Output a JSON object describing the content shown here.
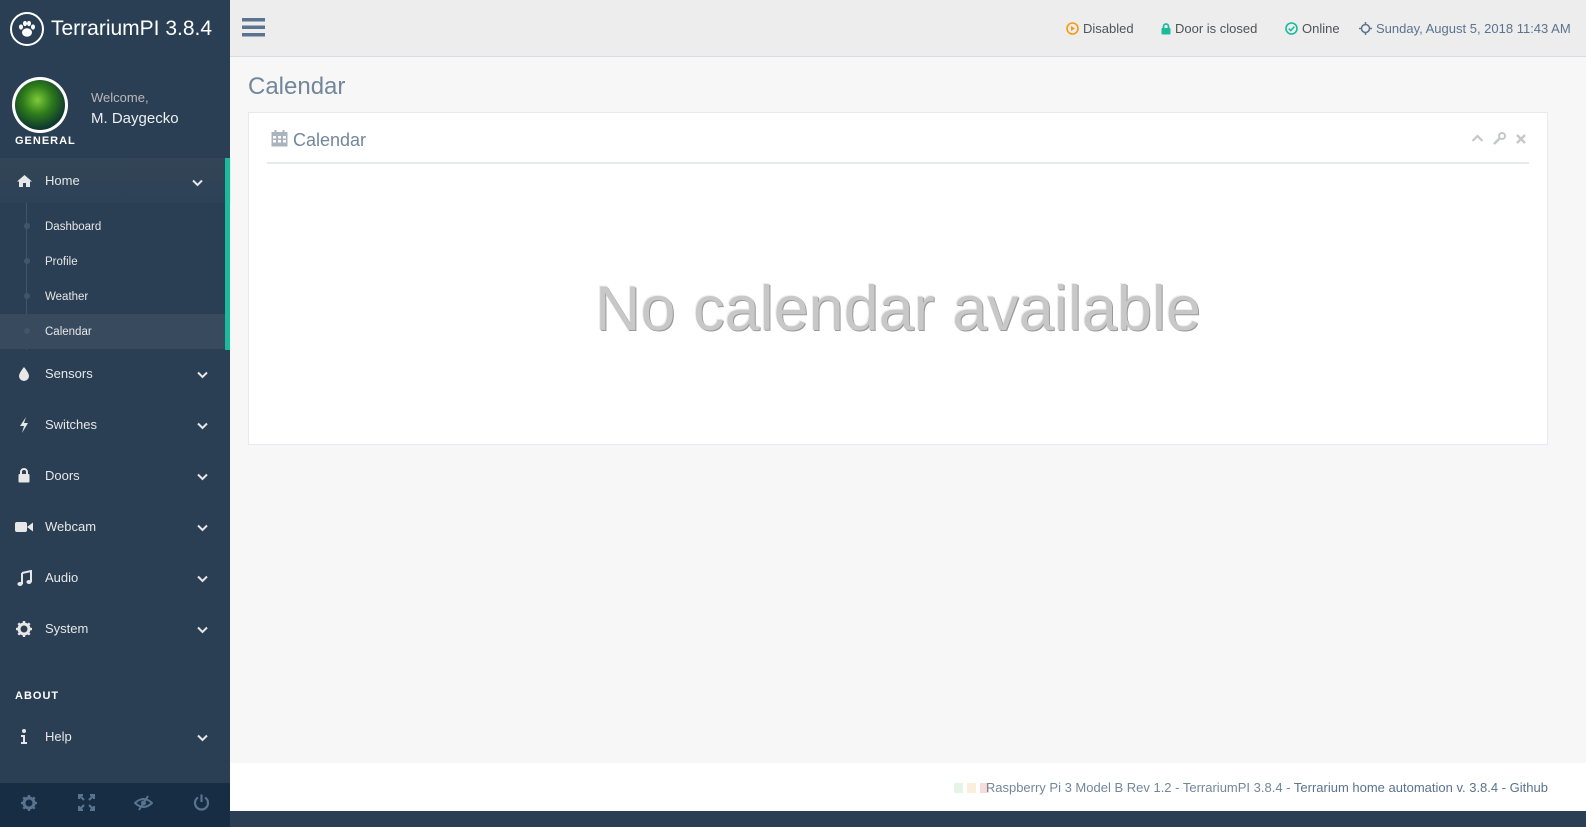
{
  "brand": {
    "title": "TerrariumPI 3.8.4"
  },
  "profile": {
    "welcome": "Welcome,",
    "name": "M. Daygecko"
  },
  "sidebar": {
    "general_title": "GENERAL",
    "about_title": "ABOUT",
    "home": {
      "label": "Home",
      "icon": "home-icon"
    },
    "home_submenu": [
      "Dashboard",
      "Profile",
      "Weather",
      "Calendar"
    ],
    "items": [
      {
        "label": "Sensors",
        "icon": "tint-icon"
      },
      {
        "label": "Switches",
        "icon": "bolt-icon"
      },
      {
        "label": "Doors",
        "icon": "lock-icon"
      },
      {
        "label": "Webcam",
        "icon": "video-icon"
      },
      {
        "label": "Audio",
        "icon": "music-icon"
      },
      {
        "label": "System",
        "icon": "gear-icon"
      }
    ],
    "help": {
      "label": "Help",
      "icon": "info-icon"
    },
    "footer_icons": [
      "gear-icon",
      "fullscreen-icon",
      "eye-slash-icon",
      "power-icon"
    ]
  },
  "topnav": {
    "engine_status": "Disabled",
    "door_status": "Door is closed",
    "connection_status": "Online",
    "datetime": "Sunday, August 5, 2018 11:43 AM"
  },
  "page": {
    "title": "Calendar"
  },
  "panel": {
    "title": "Calendar",
    "empty_message": "No calendar available"
  },
  "footer": {
    "text": "Raspberry Pi 3 Model B Rev 1.2 - TerrariumPI 3.8.4 - ",
    "link": "Terrarium home automation v. 3.8.4 - Github"
  },
  "colors": {
    "accent": "#1abb9c",
    "sidebar": "#2a3f54",
    "warning": "#f39c12",
    "success": "#1abb9c"
  }
}
